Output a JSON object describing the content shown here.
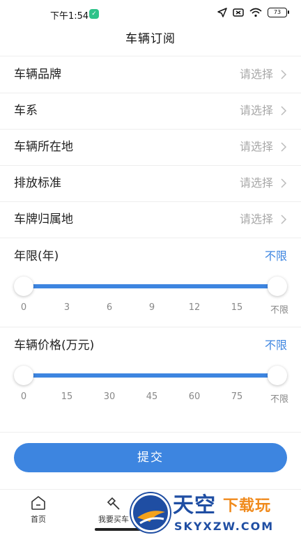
{
  "status_bar": {
    "time": "下午1:54",
    "battery": "73"
  },
  "page_title": "车辆订阅",
  "form": {
    "rows": [
      {
        "label": "车辆品牌",
        "value": "请选择"
      },
      {
        "label": "车系",
        "value": "请选择"
      },
      {
        "label": "车辆所在地",
        "value": "请选择"
      },
      {
        "label": "排放标准",
        "value": "请选择"
      },
      {
        "label": "车牌归属地",
        "value": "请选择"
      }
    ]
  },
  "age_range": {
    "label": "年限(年)",
    "value": "不限",
    "ticks": [
      "0",
      "3",
      "6",
      "9",
      "12",
      "15",
      "不限"
    ],
    "selected_min": 0,
    "selected_max": "不限"
  },
  "price_range": {
    "label": "车辆价格(万元)",
    "value": "不限",
    "ticks": [
      "0",
      "15",
      "30",
      "45",
      "60",
      "75",
      "不限"
    ],
    "selected_min": 0,
    "selected_max": "不限"
  },
  "submit_label": "提交",
  "tab_bar": {
    "tabs": [
      {
        "label": "首页",
        "icon": "home-icon"
      },
      {
        "label": "我要买车",
        "icon": "hammer-icon"
      }
    ]
  },
  "watermark": {
    "big": "天空",
    "orange": "下载玩",
    "sub": "SKYXZW.COM"
  },
  "colors": {
    "accent": "#3d85e0",
    "placeholder": "#a8a8a8"
  }
}
